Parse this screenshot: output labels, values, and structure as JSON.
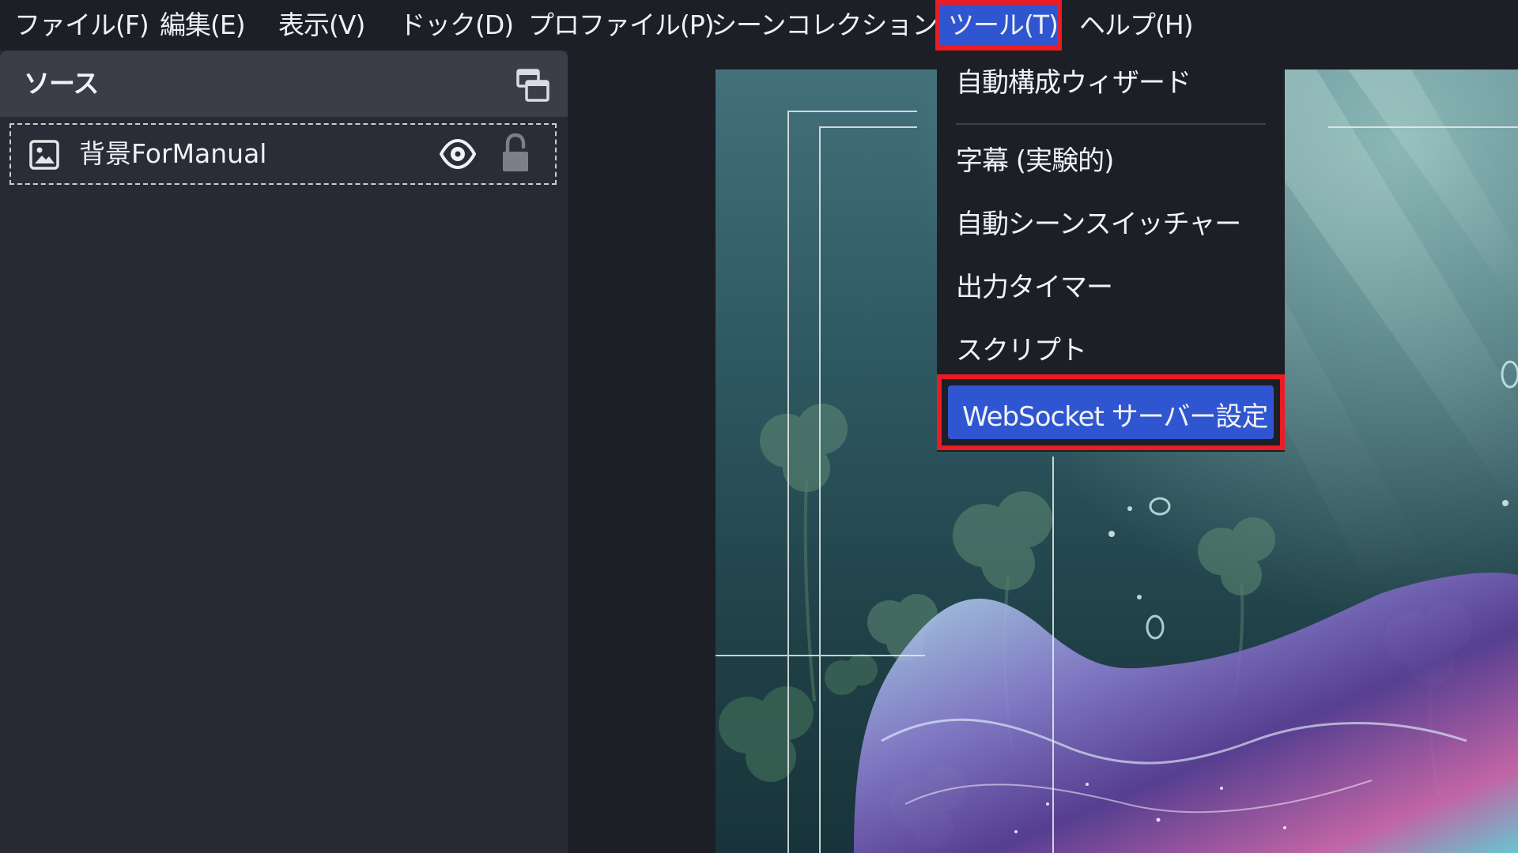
{
  "menubar": {
    "items": [
      {
        "label": "ファイル(F)"
      },
      {
        "label": "編集(E)"
      },
      {
        "label": "表示(V)"
      },
      {
        "label": "ドック(D)"
      },
      {
        "label": "プロファイル(P)"
      },
      {
        "label": "シーンコレクション(S)"
      },
      {
        "label": "ツール(T)"
      },
      {
        "label": "ヘルプ(H)"
      }
    ]
  },
  "sources_dock": {
    "title": "ソース",
    "undock_icon": "undock-icon",
    "items": [
      {
        "label": "背景ForManual",
        "type_icon": "image-icon",
        "visibility_icon": "eye-icon",
        "lock_icon": "unlocked-icon"
      }
    ]
  },
  "tools_menu": {
    "items": [
      {
        "label": "自動構成ウィザード"
      },
      {
        "label": "字幕 (実験的)"
      },
      {
        "label": "自動シーンスイッチャー"
      },
      {
        "label": "出力タイマー"
      },
      {
        "label": "スクリプト"
      },
      {
        "label": "WebSocket サーバー設定"
      }
    ],
    "highlighted_item": "WebSocket サーバー設定"
  },
  "colors": {
    "menubar_bg": "#1d1f26",
    "dock_bg": "#272a34",
    "dock_header_bg": "#3b3e49",
    "accent_blue": "#2f56d0",
    "highlight_red": "#ea1c24"
  }
}
